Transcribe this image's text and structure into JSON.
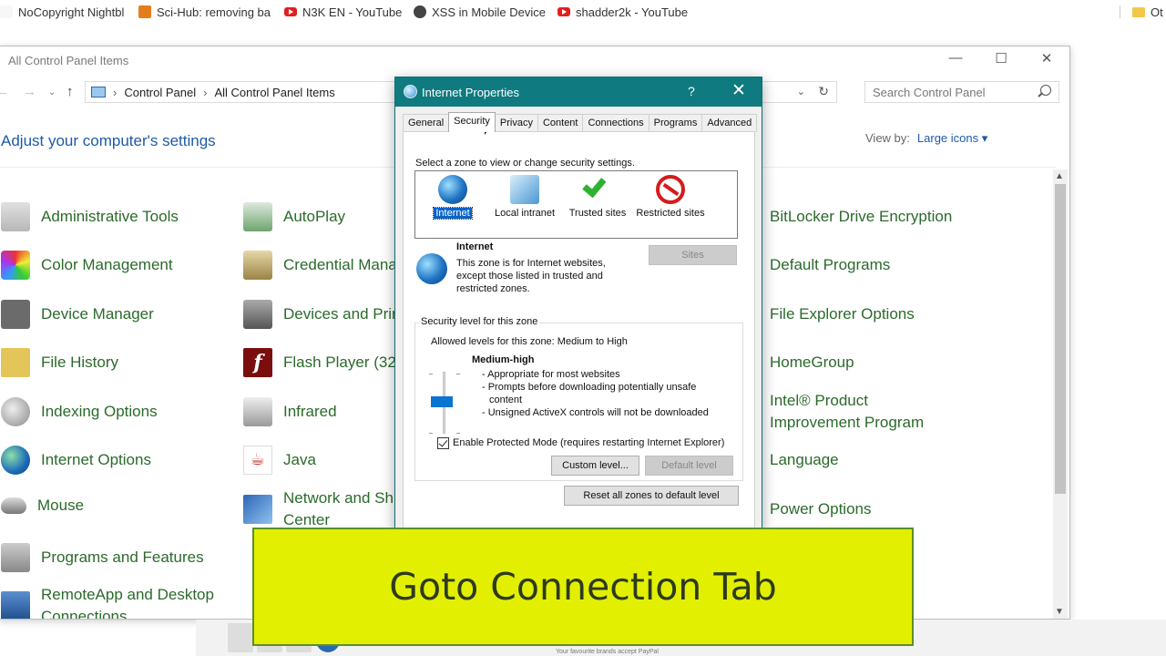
{
  "bookmarks": [
    {
      "label": "NoCopyright Nightbl",
      "icon": "favicon-icon"
    },
    {
      "label": "Sci-Hub: removing ba",
      "icon": "scihub-icon"
    },
    {
      "label": "N3K EN - YouTube",
      "icon": "youtube-icon"
    },
    {
      "label": "XSS in Mobile Device",
      "icon": "bug-icon"
    },
    {
      "label": "shadder2k - YouTube",
      "icon": "youtube-icon"
    },
    {
      "label": "Ot",
      "icon": "folder-icon"
    }
  ],
  "window": {
    "title": "All Control Panel Items",
    "breadcrumb": [
      "Control Panel",
      "All Control Panel Items"
    ],
    "search_placeholder": "Search Control Panel",
    "heading": "Adjust your computer's settings",
    "view_by_label": "View by:",
    "view_by_value": "Large icons ▾"
  },
  "items_col1": [
    "Administrative Tools",
    "Color Management",
    "Device Manager",
    "File History",
    "Indexing Options",
    "Internet Options",
    "Mouse",
    "Programs and Features",
    "RemoteApp and Desktop Connections"
  ],
  "items_col2": [
    "AutoPlay",
    "Credential Mana",
    "Devices and Prin",
    "Flash Player (32-",
    "Infrared",
    "Java",
    "Network and Sh Center"
  ],
  "items_col3": [
    "BitLocker Drive Encryption",
    "Default Programs",
    "File Explorer Options",
    "HomeGroup",
    "Intel® Product Improvement Program",
    "Language",
    "Power Options"
  ],
  "dialog": {
    "title": "Internet Properties",
    "help": "?",
    "close": "✕",
    "tabs": [
      "General",
      "Security",
      "Privacy",
      "Content",
      "Connections",
      "Programs",
      "Advanced"
    ],
    "active_tab": "Security",
    "zone_prompt": "Select a zone to view or change security settings.",
    "zones": [
      "Internet",
      "Local intranet",
      "Trusted sites",
      "Restricted sites"
    ],
    "zone_name": "Internet",
    "zone_desc_1": "This zone is for Internet websites,",
    "zone_desc_2": "except those listed in trusted and",
    "zone_desc_3": "restricted zones.",
    "sites_button": "Sites",
    "group_label": "Security level for this zone",
    "allowed_levels": "Allowed levels for this zone: Medium to High",
    "level_name": "Medium-high",
    "level_points": [
      "- Appropriate for most websites",
      "- Prompts before downloading potentially unsafe",
      "  content",
      "- Unsigned ActiveX controls will not be downloaded"
    ],
    "protected_mode": "Enable Protected Mode (requires restarting Internet Explorer)",
    "custom_level": "Custom level...",
    "default_level": "Default level",
    "reset_all": "Reset all zones to default level"
  },
  "strip_text": "Your favourite brands accept PayPal",
  "caption": "Goto Connection Tab"
}
